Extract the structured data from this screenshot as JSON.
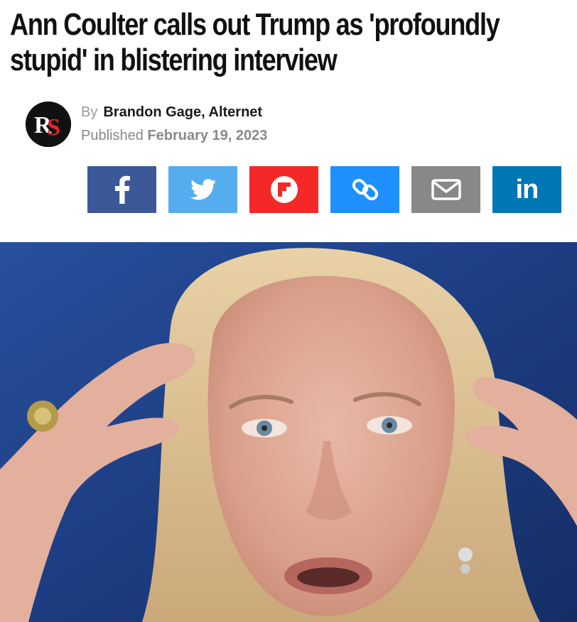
{
  "article": {
    "headline": "Ann Coulter calls out Trump as 'profoundly stupid' in blistering interview",
    "byline_prefix": "By",
    "author": "Brandon Gage, Alternet",
    "published_prefix": "Published",
    "published_date": "February 19, 2023",
    "publisher_logo_text": "RS"
  },
  "share": {
    "buttons": [
      {
        "name": "facebook",
        "icon": "facebook-icon",
        "color": "#3b5998"
      },
      {
        "name": "twitter",
        "icon": "twitter-icon",
        "color": "#55acee"
      },
      {
        "name": "flipboard",
        "icon": "flipboard-icon",
        "color": "#f52828"
      },
      {
        "name": "copy-link",
        "icon": "link-icon",
        "color": "#1e90ff"
      },
      {
        "name": "email",
        "icon": "email-icon",
        "color": "#888888"
      },
      {
        "name": "linkedin",
        "icon": "linkedin-icon",
        "color": "#0077b5"
      }
    ],
    "linkedin_label": "in"
  },
  "colors": {
    "headline": "#111111",
    "hero_background": "#1f3f86"
  }
}
